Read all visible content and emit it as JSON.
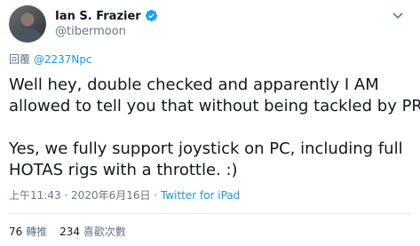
{
  "author": {
    "name": "Ian S. Frazier",
    "handle": "@tibermoon"
  },
  "reply": {
    "prefix": "回覆",
    "to": "@2237Npc"
  },
  "tweet": {
    "line1": "Well hey, double checked and apparently I AM",
    "line2": "allowed to tell you that without being tackled by PR!",
    "line3": "Yes, we fully support joystick on PC, including full",
    "line4": "HOTAS rigs with a throttle. :)"
  },
  "meta": {
    "time": "上午11:43",
    "sep1": " · ",
    "date": "2020年6月16日",
    "sep2": " · ",
    "source": "Twitter for iPad"
  },
  "stats": {
    "retweets": "76",
    "retweets_label": "轉推",
    "likes": "234",
    "likes_label": "喜歡次數"
  },
  "colors": {
    "accent": "#1b95e0",
    "muted": "#657786",
    "text": "#14171a"
  }
}
